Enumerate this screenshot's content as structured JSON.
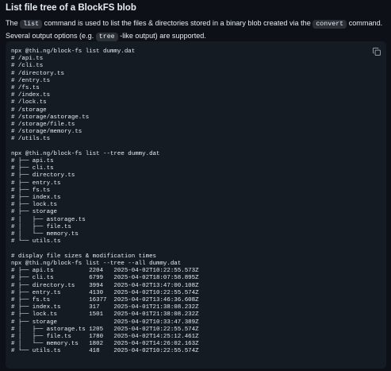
{
  "heading": "List file tree of a BlockFS blob",
  "intro": {
    "text1": "The ",
    "code1": "list",
    "text2": " command is used to list the files & directories stored in a binary blob created via the ",
    "code2": "convert",
    "text3": " command. Several output options (e.g. ",
    "code3": "tree",
    "text4": " -like output) are supported."
  },
  "copy_button": {
    "icon": "copy-icon"
  },
  "code_lines": [
    "npx @thi.ng/block-fs list dummy.dat",
    "# /api.ts",
    "# /cli.ts",
    "# /directory.ts",
    "# /entry.ts",
    "# /fs.ts",
    "# /index.ts",
    "# /lock.ts",
    "# /storage",
    "# /storage/astorage.ts",
    "# /storage/file.ts",
    "# /storage/memory.ts",
    "# /utils.ts",
    "",
    "npx @thi.ng/block-fs list --tree dummy.dat",
    "# ├── api.ts",
    "# ├── cli.ts",
    "# ├── directory.ts",
    "# ├── entry.ts",
    "# ├── fs.ts",
    "# ├── index.ts",
    "# ├── lock.ts",
    "# ├── storage",
    "# │   ├── astorage.ts",
    "# │   ├── file.ts",
    "# │   └── memory.ts",
    "# └── utils.ts",
    "",
    "# display file sizes & modification times",
    "npx @thi.ng/block-fs list --tree --all dummy.dat",
    "# ├── api.ts          2204   2025-04-02T10:22:55.573Z",
    "# ├── cli.ts          6799   2025-04-02T18:07:58.895Z",
    "# ├── directory.ts    3994   2025-04-02T13:47:00.108Z",
    "# ├── entry.ts        4130   2025-04-02T10:22:55.574Z",
    "# ├── fs.ts           16377  2025-04-02T13:46:36.608Z",
    "# ├── index.ts        317    2025-04-01T21:38:08.232Z",
    "# ├── lock.ts         1501   2025-04-01T21:38:08.232Z",
    "# ├── storage                2025-04-02T10:33:47.389Z",
    "# │   ├── astorage.ts 1205   2025-04-02T10:22:55.574Z",
    "# │   ├── file.ts     1780   2025-04-02T14:25:12.461Z",
    "# │   └── memory.ts   1802   2025-04-02T14:26:02.163Z",
    "# └── utils.ts        418    2025-04-02T10:22:55.574Z"
  ],
  "colors": {
    "background": "#0d1117",
    "code_background": "#151b23",
    "inline_code_background": "#2b3037",
    "text": "#e6edf3"
  }
}
